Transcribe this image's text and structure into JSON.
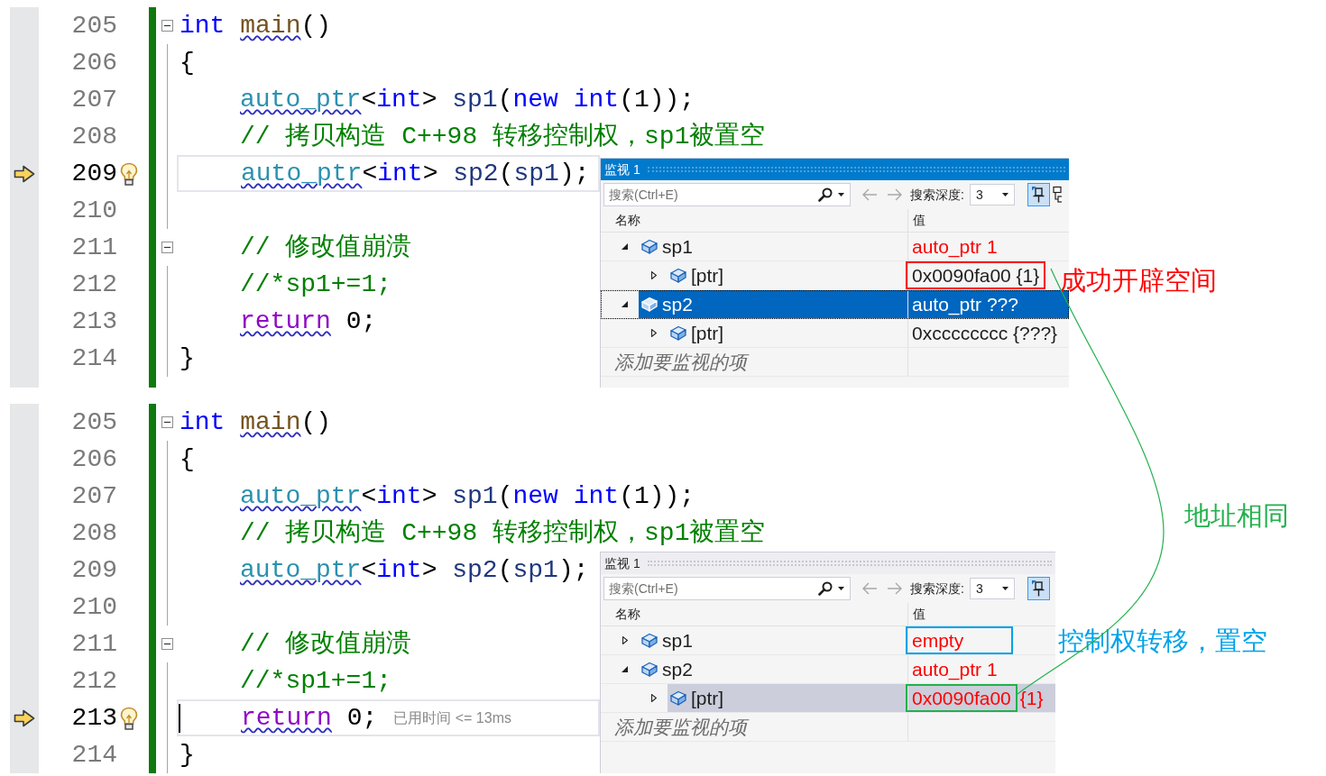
{
  "panels": [
    {
      "lines": [
        {
          "number": "205",
          "current": false,
          "cursor": false,
          "fold": true,
          "tokens": [
            {
              "text": "int ",
              "kind": "keyword",
              "squiggle": false
            },
            {
              "text": "main",
              "kind": "function",
              "squiggle": true
            },
            {
              "text": "()",
              "kind": "plain",
              "squiggle": false
            }
          ]
        },
        {
          "number": "206",
          "current": false,
          "cursor": false,
          "fold": false,
          "tokens": [
            {
              "text": "{",
              "kind": "plain",
              "squiggle": false
            }
          ],
          "children": [
            {
              "number": "207",
              "current": false,
              "cursor": false,
              "fold": false,
              "tokens": [
                {
                  "text": "auto_ptr",
                  "kind": "type",
                  "squiggle": true
                },
                {
                  "text": "<",
                  "kind": "plain",
                  "squiggle": false
                },
                {
                  "text": "int",
                  "kind": "keyword",
                  "squiggle": false
                },
                {
                  "text": "> ",
                  "kind": "plain",
                  "squiggle": false
                },
                {
                  "text": "sp1",
                  "kind": "variable",
                  "squiggle": false
                },
                {
                  "text": "(",
                  "kind": "plain",
                  "squiggle": false
                },
                {
                  "text": "new int",
                  "kind": "keyword",
                  "squiggle": false
                },
                {
                  "text": "(1));",
                  "kind": "plain",
                  "squiggle": false
                }
              ]
            },
            {
              "number": "208",
              "current": false,
              "cursor": false,
              "fold": false,
              "tokens": [
                {
                  "text": "// 拷贝构造 C++98 转移控制权，sp1被置空",
                  "kind": "comment",
                  "squiggle": false
                }
              ]
            },
            {
              "number": "209",
              "current": true,
              "cursor": false,
              "fold": false,
              "tokens": [
                {
                  "text": "auto_ptr",
                  "kind": "type",
                  "squiggle": true
                },
                {
                  "text": "<",
                  "kind": "plain",
                  "squiggle": false
                },
                {
                  "text": "int",
                  "kind": "keyword",
                  "squiggle": false
                },
                {
                  "text": "> ",
                  "kind": "plain",
                  "squiggle": false
                },
                {
                  "text": "sp2",
                  "kind": "variable",
                  "squiggle": false
                },
                {
                  "text": "(",
                  "kind": "plain",
                  "squiggle": false
                },
                {
                  "text": "sp1",
                  "kind": "variable",
                  "squiggle": false
                },
                {
                  "text": ");",
                  "kind": "plain",
                  "squiggle": false
                }
              ]
            },
            {
              "number": "210",
              "current": false,
              "cursor": false,
              "fold": false
            },
            {
              "number": "211",
              "current": false,
              "cursor": false,
              "fold": true,
              "tokens": [
                {
                  "text": "// 修改值崩溃",
                  "kind": "comment",
                  "squiggle": false
                }
              ]
            },
            {
              "number": "212",
              "current": false,
              "cursor": false,
              "fold": false,
              "tokens": [
                {
                  "text": "//*sp1+=1;",
                  "kind": "comment",
                  "squiggle": false
                }
              ]
            },
            {
              "number": "213",
              "current": false,
              "cursor": false,
              "fold": false,
              "tokens": [
                {
                  "text": "return",
                  "kind": "control",
                  "squiggle": true
                },
                {
                  "text": " 0;",
                  "kind": "plain",
                  "squiggle": false
                }
              ]
            }
          ]
        },
        {
          "number": "214",
          "current": false,
          "cursor": false,
          "fold": false,
          "tokens": [
            {
              "text": "}",
              "kind": "plain",
              "squiggle": false
            }
          ]
        }
      ],
      "watch": {
        "title": "监视 1",
        "active": true,
        "search_placeholder": "搜索(Ctrl+E)",
        "nav_disabled": true,
        "depth_label": "搜索深度:",
        "depth": "3",
        "pin_selected": true,
        "columns": [
          "名称",
          "值"
        ],
        "rows": [
          {
            "name": "sp1",
            "value": "auto_ptr 1",
            "changed": true,
            "expanded": true,
            "selected": false,
            "children": [
              {
                "name": "[ptr]",
                "value": "0x0090fa00 {1}",
                "changed": false,
                "expanded": false,
                "selected": false,
                "annotation_box": {
                  "color": "#ff0000"
                }
              }
            ]
          },
          {
            "name": "sp2",
            "value": "auto_ptr ???",
            "changed": false,
            "expanded": true,
            "selected": true,
            "children": [
              {
                "name": "[ptr]",
                "value": "0xcccccccc {???}",
                "changed": false,
                "expanded": false,
                "selected": false
              }
            ]
          }
        ],
        "add_placeholder": "添加要监视的项"
      }
    },
    {
      "lines": [
        {
          "number": "205",
          "current": false,
          "cursor": false,
          "fold": true,
          "tokens": [
            {
              "text": "int ",
              "kind": "keyword",
              "squiggle": false
            },
            {
              "text": "main",
              "kind": "function",
              "squiggle": true
            },
            {
              "text": "()",
              "kind": "plain",
              "squiggle": false
            }
          ]
        },
        {
          "number": "206",
          "current": false,
          "cursor": false,
          "fold": false,
          "tokens": [
            {
              "text": "{",
              "kind": "plain",
              "squiggle": false
            }
          ],
          "children": [
            {
              "number": "207",
              "current": false,
              "cursor": false,
              "fold": false,
              "tokens": [
                {
                  "text": "auto_ptr",
                  "kind": "type",
                  "squiggle": true
                },
                {
                  "text": "<",
                  "kind": "plain",
                  "squiggle": false
                },
                {
                  "text": "int",
                  "kind": "keyword",
                  "squiggle": false
                },
                {
                  "text": "> ",
                  "kind": "plain",
                  "squiggle": false
                },
                {
                  "text": "sp1",
                  "kind": "variable",
                  "squiggle": false
                },
                {
                  "text": "(",
                  "kind": "plain",
                  "squiggle": false
                },
                {
                  "text": "new int",
                  "kind": "keyword",
                  "squiggle": false
                },
                {
                  "text": "(1));",
                  "kind": "plain",
                  "squiggle": false
                }
              ]
            },
            {
              "number": "208",
              "current": false,
              "cursor": false,
              "fold": false,
              "tokens": [
                {
                  "text": "// 拷贝构造 C++98 转移控制权，sp1被置空",
                  "kind": "comment",
                  "squiggle": false
                }
              ]
            },
            {
              "number": "209",
              "current": false,
              "cursor": false,
              "fold": false,
              "tokens": [
                {
                  "text": "auto_ptr",
                  "kind": "type",
                  "squiggle": true
                },
                {
                  "text": "<",
                  "kind": "plain",
                  "squiggle": false
                },
                {
                  "text": "int",
                  "kind": "keyword",
                  "squiggle": false
                },
                {
                  "text": "> ",
                  "kind": "plain",
                  "squiggle": false
                },
                {
                  "text": "sp2",
                  "kind": "variable",
                  "squiggle": false
                },
                {
                  "text": "(",
                  "kind": "plain",
                  "squiggle": false
                },
                {
                  "text": "sp1",
                  "kind": "variable",
                  "squiggle": false
                },
                {
                  "text": ");",
                  "kind": "plain",
                  "squiggle": false
                }
              ]
            },
            {
              "number": "210",
              "current": false,
              "cursor": false,
              "fold": false
            },
            {
              "number": "211",
              "current": false,
              "cursor": false,
              "fold": true,
              "tokens": [
                {
                  "text": "// 修改值崩溃",
                  "kind": "comment",
                  "squiggle": false
                }
              ]
            },
            {
              "number": "212",
              "current": false,
              "cursor": false,
              "fold": false,
              "tokens": [
                {
                  "text": "//*sp1+=1;",
                  "kind": "comment",
                  "squiggle": false
                }
              ]
            },
            {
              "number": "213",
              "current": true,
              "cursor": true,
              "fold": false,
              "hint": "已用时间 <= 13ms",
              "tokens": [
                {
                  "text": "return",
                  "kind": "control",
                  "squiggle": true
                },
                {
                  "text": " 0;",
                  "kind": "plain",
                  "squiggle": false
                }
              ]
            }
          ]
        },
        {
          "number": "214",
          "current": false,
          "cursor": false,
          "fold": false,
          "tokens": [
            {
              "text": "}",
              "kind": "plain",
              "squiggle": false
            }
          ]
        }
      ],
      "watch": {
        "title": "监视 1",
        "active": false,
        "search_placeholder": "搜索(Ctrl+E)",
        "nav_disabled": true,
        "depth_label": "搜索深度:",
        "depth": "3",
        "pin_selected": true,
        "columns": [
          "名称",
          "值"
        ],
        "rows": [
          {
            "name": "sp1",
            "value": "empty",
            "changed": true,
            "expanded": false,
            "selected": false,
            "annotation_box": {
              "color": "#00a2e8"
            }
          },
          {
            "name": "sp2",
            "value": "auto_ptr 1",
            "changed": true,
            "expanded": true,
            "selected": false,
            "children": [
              {
                "name": "[ptr]",
                "value": "0x0090fa00",
                "value_tail": "{1}",
                "changed": true,
                "expanded": false,
                "selected": true,
                "annotation_box": {
                  "color": "#22b14c"
                }
              }
            ]
          }
        ],
        "add_placeholder": "添加要监视的项"
      }
    }
  ],
  "annotations": [
    {
      "text": "成功开辟空间",
      "color": "#ff0000"
    },
    {
      "text": "地址相同",
      "color": "#22b14c"
    },
    {
      "text": "控制权转移，置空",
      "color": "#00a2e8"
    }
  ]
}
